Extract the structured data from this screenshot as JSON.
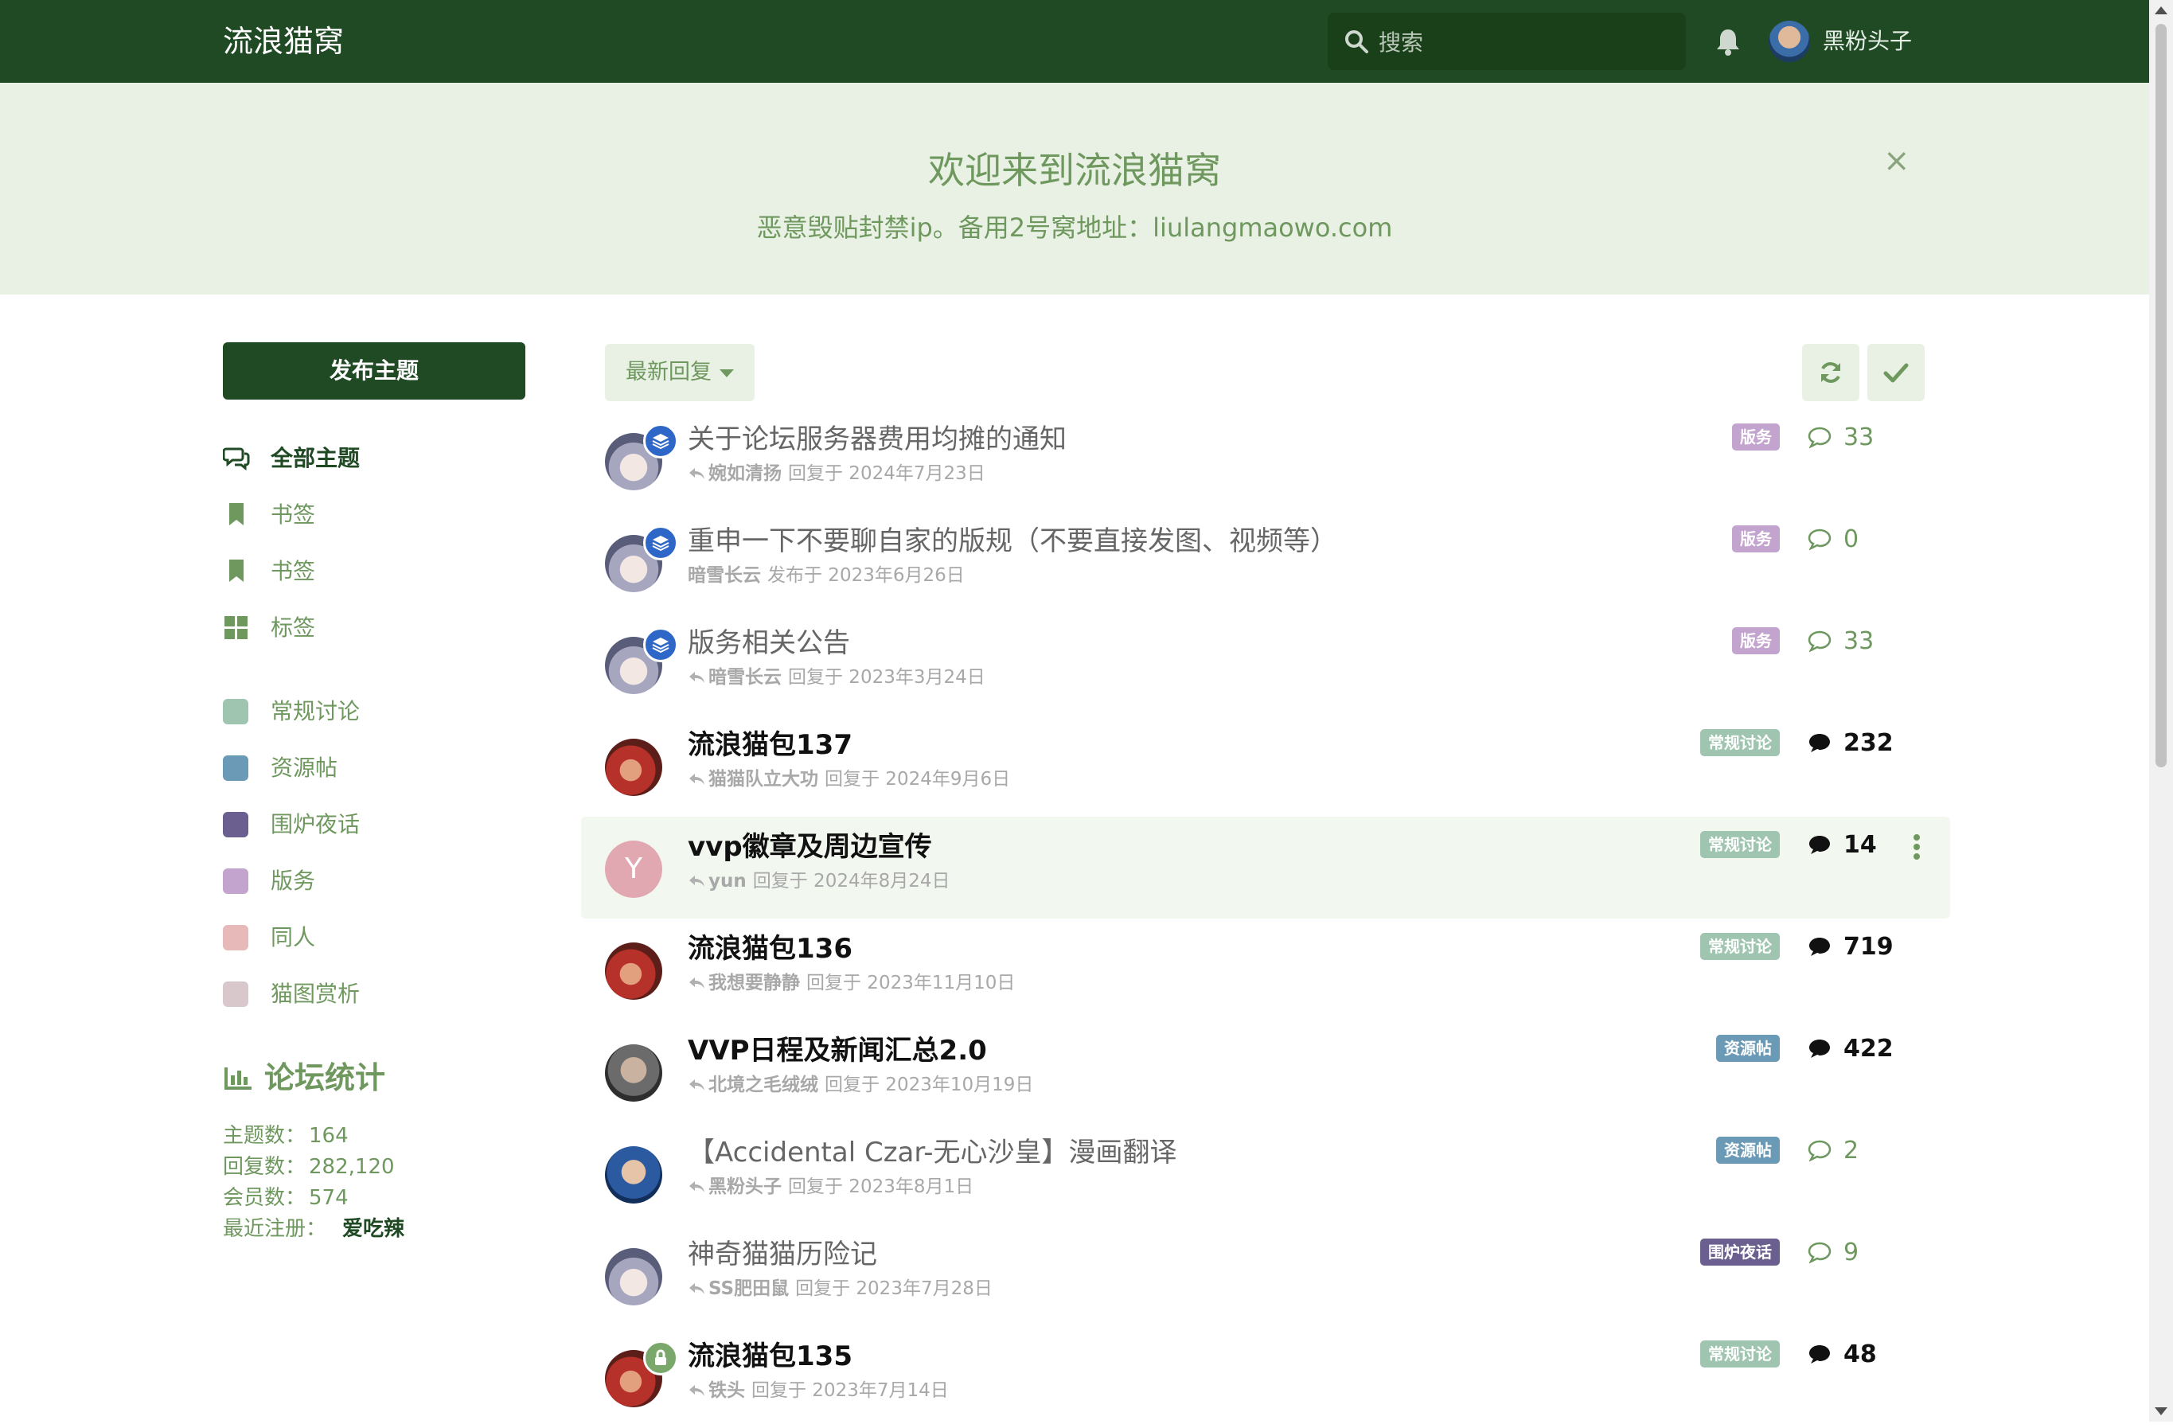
{
  "header": {
    "site_title": "流浪猫窝",
    "search_placeholder": "搜索",
    "username": "黑粉头子"
  },
  "hero": {
    "title": "欢迎来到流浪猫窝",
    "subtitle": "恶意毁贴封禁ip。备用2号窝地址：liulangmaowo.com",
    "close": "×"
  },
  "sidebar": {
    "compose_label": "发布主题",
    "nav": [
      {
        "label": "全部主题",
        "icon": "comments-icon"
      },
      {
        "label": "书签",
        "icon": "bookmark-icon"
      },
      {
        "label": "书签",
        "icon": "bookmark-icon"
      },
      {
        "label": "标签",
        "icon": "grid-icon"
      }
    ],
    "tags": [
      {
        "label": "常规讨论",
        "color": "#9fc5b0"
      },
      {
        "label": "资源帖",
        "color": "#6a9ab5"
      },
      {
        "label": "围炉夜话",
        "color": "#6b5f90"
      },
      {
        "label": "版务",
        "color": "#c3a4cf"
      },
      {
        "label": "同人",
        "color": "#e7b9b9"
      },
      {
        "label": "猫图赏析",
        "color": "#d8c8cc"
      }
    ],
    "stats": {
      "title": "论坛统计",
      "topics_label": "主题数：",
      "topics": "164",
      "replies_label": "回复数：",
      "replies": "282,120",
      "members_label": "会员数：",
      "members": "574",
      "newest_label": "最近注册：",
      "newest": "爱吃辣"
    }
  },
  "toolbar": {
    "sort_label": "最新回复",
    "refresh_icon": "refresh-icon",
    "mark_read_icon": "check-icon"
  },
  "discussions": [
    {
      "title": "关于论坛服务器费用均摊的通知",
      "user": "婉如清扬",
      "action": "回复于 2024年7月23日",
      "tag": "版务",
      "tag_color": "#c3a4cf",
      "count": "33",
      "state": "read",
      "badge": "pinned",
      "avatar": "girl",
      "reply": true
    },
    {
      "title": "重申一下不要聊自家的版规（不要直接发图、视频等）",
      "user": "暗雪长云",
      "action": "发布于 2023年6月26日",
      "tag": "版务",
      "tag_color": "#c3a4cf",
      "count": "0",
      "state": "read",
      "badge": "pinned",
      "avatar": "girl",
      "reply": false
    },
    {
      "title": "版务相关公告",
      "user": "暗雪长云",
      "action": "回复于 2023年3月24日",
      "tag": "版务",
      "tag_color": "#c3a4cf",
      "count": "33",
      "state": "read",
      "badge": "pinned",
      "avatar": "girl",
      "reply": true
    },
    {
      "title": "流浪猫包137",
      "user": "猫猫队立大功",
      "action": "回复于 2024年9月6日",
      "tag": "常规讨论",
      "tag_color": "#9fc5b0",
      "count": "232",
      "state": "unread",
      "badge": "",
      "avatar": "red",
      "reply": true
    },
    {
      "title": "vvp徽章及周边宣传",
      "user": "yun",
      "action": "回复于 2024年8月24日",
      "tag": "常规讨论",
      "tag_color": "#9fc5b0",
      "count": "14",
      "state": "unread",
      "badge": "",
      "avatar": "letter",
      "avatar_letter": "Y",
      "reply": true,
      "highlight": true
    },
    {
      "title": "流浪猫包136",
      "user": "我想要静静",
      "action": "回复于 2023年11月10日",
      "tag": "常规讨论",
      "tag_color": "#9fc5b0",
      "count": "719",
      "state": "unread",
      "badge": "",
      "avatar": "red",
      "reply": true
    },
    {
      "title": "VVP日程及新闻汇总2.0",
      "user": "北境之毛绒绒",
      "action": "回复于 2023年10月19日",
      "tag": "资源帖",
      "tag_color": "#6a9ab5",
      "count": "422",
      "state": "unread",
      "badge": "",
      "avatar": "man",
      "reply": true
    },
    {
      "title": "【Accidental Czar-无心沙皇】漫画翻译",
      "user": "黑粉头子",
      "action": "回复于 2023年8月1日",
      "tag": "资源帖",
      "tag_color": "#6a9ab5",
      "count": "2",
      "state": "read",
      "badge": "",
      "avatar": "blue",
      "reply": true
    },
    {
      "title": "神奇猫猫历险记",
      "user": "SS肥田鼠",
      "action": "回复于 2023年7月28日",
      "tag": "围炉夜话",
      "tag_color": "#6b5f90",
      "count": "9",
      "state": "read",
      "badge": "",
      "avatar": "girl",
      "reply": true
    },
    {
      "title": "流浪猫包135",
      "user": "铁头",
      "action": "回复于 2023年7月14日",
      "tag": "常规讨论",
      "tag_color": "#9fc5b0",
      "count": "48",
      "state": "unread",
      "badge": "locked",
      "avatar": "red",
      "reply": true
    }
  ]
}
